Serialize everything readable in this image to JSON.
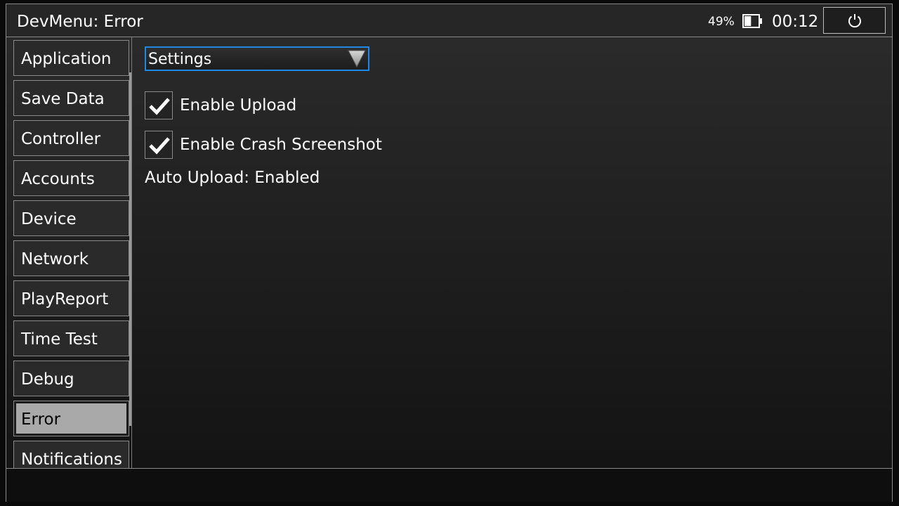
{
  "header": {
    "title": "DevMenu: Error",
    "battery_percent": "49%",
    "battery_level": 0.49,
    "clock": "00:12"
  },
  "sidebar": {
    "items": [
      {
        "label": "Application"
      },
      {
        "label": "Save Data"
      },
      {
        "label": "Controller"
      },
      {
        "label": "Accounts"
      },
      {
        "label": "Device"
      },
      {
        "label": "Network"
      },
      {
        "label": "PlayReport"
      },
      {
        "label": "Time Test"
      },
      {
        "label": "Debug"
      },
      {
        "label": "Error",
        "selected": true
      },
      {
        "label": "Notifications"
      }
    ]
  },
  "main": {
    "dropdown": {
      "selected": "Settings"
    },
    "options": [
      {
        "label": "Enable Upload",
        "checked": true
      },
      {
        "label": "Enable Crash Screenshot",
        "checked": true
      }
    ],
    "status": "Auto Upload: Enabled"
  },
  "colors": {
    "accent": "#1e88e5",
    "selected_bg": "#a9a9a9",
    "border": "#8a8a8a"
  },
  "icons": {
    "battery": "battery-icon",
    "power": "power-icon",
    "dropdown_arrow": "chevron-down-icon",
    "check": "checkmark-icon"
  }
}
